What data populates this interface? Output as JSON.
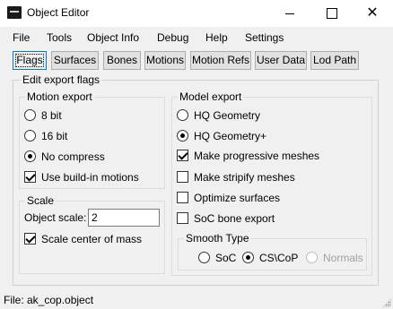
{
  "window": {
    "title": "Object Editor",
    "icon": "app-icon",
    "controls": {
      "minimize": "minimize-icon",
      "maximize": "maximize-icon",
      "close": "✕"
    }
  },
  "menu": [
    "File",
    "Tools",
    "Object Info",
    "Debug",
    "Help",
    "Settings"
  ],
  "tabs": [
    {
      "label": "Flags",
      "active": true
    },
    {
      "label": "Surfaces"
    },
    {
      "label": "Bones"
    },
    {
      "label": "Motions"
    },
    {
      "label": "Motion Refs"
    },
    {
      "label": "User Data"
    },
    {
      "label": "Lod Path"
    }
  ],
  "export_flags": {
    "title": "Edit export flags",
    "motion_export": {
      "title": "Motion export",
      "options": [
        {
          "label": "8 bit",
          "type": "radio",
          "checked": false
        },
        {
          "label": "16 bit",
          "type": "radio",
          "checked": false
        },
        {
          "label": "No compress",
          "type": "radio",
          "checked": true
        },
        {
          "label": "Use build-in motions",
          "type": "check",
          "checked": true
        }
      ]
    },
    "scale": {
      "title": "Scale",
      "object_scale_label": "Object scale:",
      "object_scale_value": "2",
      "scale_center_of_mass": {
        "label": "Scale center of mass",
        "checked": true
      }
    },
    "model_export": {
      "title": "Model export",
      "options": [
        {
          "label": "HQ Geometry",
          "type": "radio",
          "checked": false
        },
        {
          "label": "HQ Geometry+",
          "type": "radio",
          "checked": true
        },
        {
          "label": "Make progressive meshes",
          "type": "check",
          "checked": true
        },
        {
          "label": "Make stripify meshes",
          "type": "check",
          "checked": false
        },
        {
          "label": "Optimize surfaces",
          "type": "check",
          "checked": false
        },
        {
          "label": "SoC bone export",
          "type": "check",
          "checked": false
        }
      ],
      "smooth_type": {
        "title": "Smooth Type",
        "options": [
          {
            "label": "SoC",
            "checked": false,
            "enabled": true
          },
          {
            "label": "CS\\CoP",
            "checked": true,
            "enabled": true
          },
          {
            "label": "Normals",
            "checked": false,
            "enabled": false
          }
        ]
      }
    }
  },
  "status": {
    "text": "File:  ak_cop.object"
  }
}
